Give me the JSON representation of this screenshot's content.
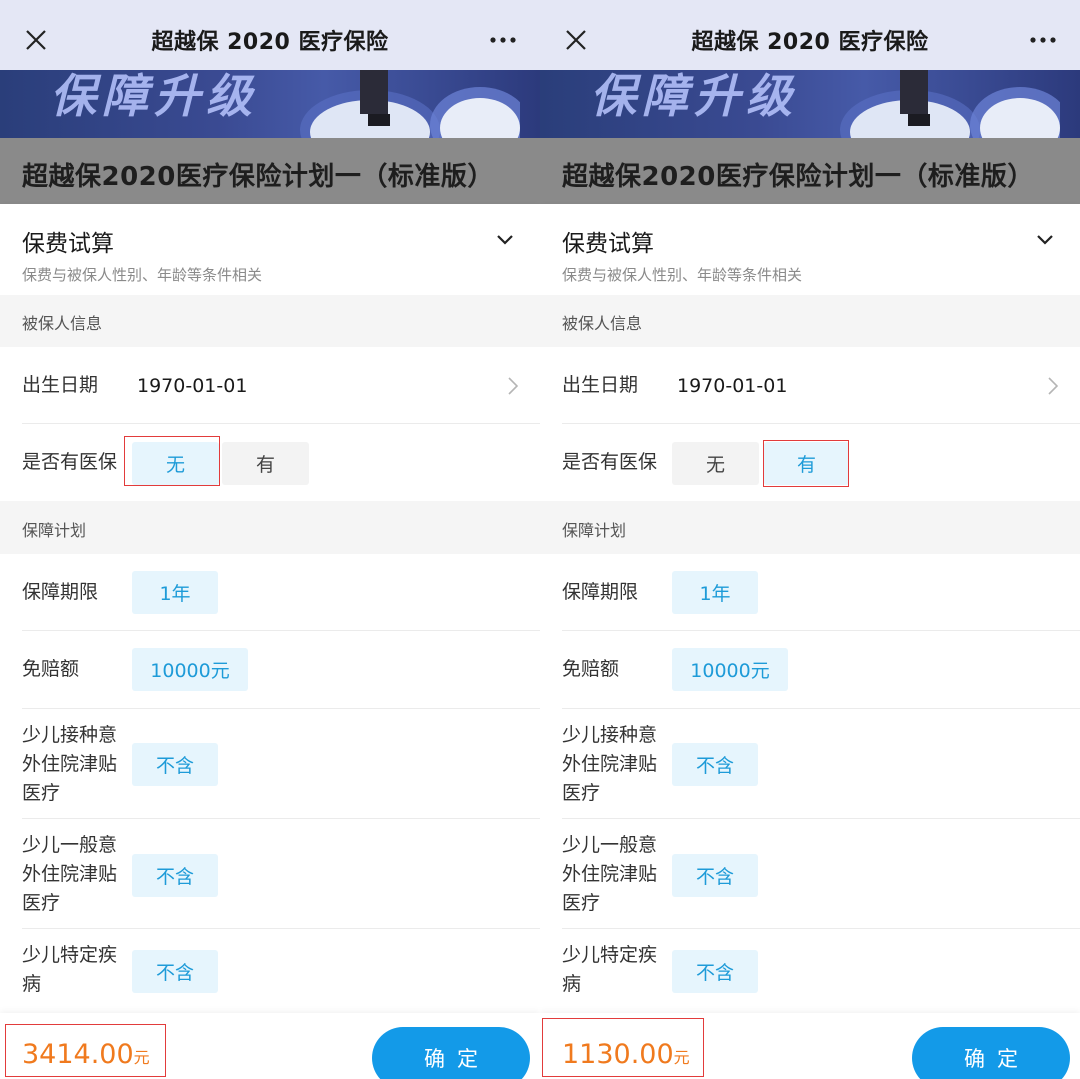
{
  "panels": [
    {
      "header": {
        "title": "超越保 2020 医疗保险"
      },
      "banner": {
        "text": "保障升级"
      },
      "plan_title": "超越保2020医疗保险计划一（标准版）",
      "calc": {
        "title": "保费试算",
        "subtitle": "保费与被保人性别、年龄等条件相关"
      },
      "section_insured": "被保人信息",
      "birth": {
        "label": "出生日期",
        "value": "1970-01-01"
      },
      "insurance": {
        "label": "是否有医保",
        "option_no": "无",
        "option_yes": "有",
        "selected": "无"
      },
      "section_plan": "保障计划",
      "term": {
        "label": "保障期限",
        "value": "1年"
      },
      "deductible": {
        "label": "免赔额",
        "value": "10000元"
      },
      "child_vacc": {
        "label_1": "少儿接种意",
        "label_2": "外住院津贴",
        "label_3": "医疗",
        "value": "不含"
      },
      "child_acc": {
        "label_1": "少儿一般意",
        "label_2": "外住院津贴",
        "label_3": "医疗",
        "value": "不含"
      },
      "child_disease": {
        "label_1": "少儿特定疾",
        "label_2": "病",
        "value": "不含"
      },
      "footer": {
        "price": "3414.00",
        "unit": "元",
        "confirm": "确定"
      }
    },
    {
      "header": {
        "title": "超越保 2020 医疗保险"
      },
      "banner": {
        "text": "保障升级"
      },
      "plan_title": "超越保2020医疗保险计划一（标准版）",
      "calc": {
        "title": "保费试算",
        "subtitle": "保费与被保人性别、年龄等条件相关"
      },
      "section_insured": "被保人信息",
      "birth": {
        "label": "出生日期",
        "value": "1970-01-01"
      },
      "insurance": {
        "label": "是否有医保",
        "option_no": "无",
        "option_yes": "有",
        "selected": "有"
      },
      "section_plan": "保障计划",
      "term": {
        "label": "保障期限",
        "value": "1年"
      },
      "deductible": {
        "label": "免赔额",
        "value": "10000元"
      },
      "child_vacc": {
        "label_1": "少儿接种意",
        "label_2": "外住院津贴",
        "label_3": "医疗",
        "value": "不含"
      },
      "child_acc": {
        "label_1": "少儿一般意",
        "label_2": "外住院津贴",
        "label_3": "医疗",
        "value": "不含"
      },
      "child_disease": {
        "label_1": "少儿特定疾",
        "label_2": "病",
        "value": "不含"
      },
      "footer": {
        "price": "1130.00",
        "unit": "元",
        "confirm": "确定"
      }
    }
  ],
  "colors": {
    "accent": "#139ae8",
    "chip_selected_bg": "#e6f5fd",
    "chip_selected_text": "#1e9bd8",
    "price": "#f07a1e",
    "highlight_box": "#e23b3b"
  }
}
